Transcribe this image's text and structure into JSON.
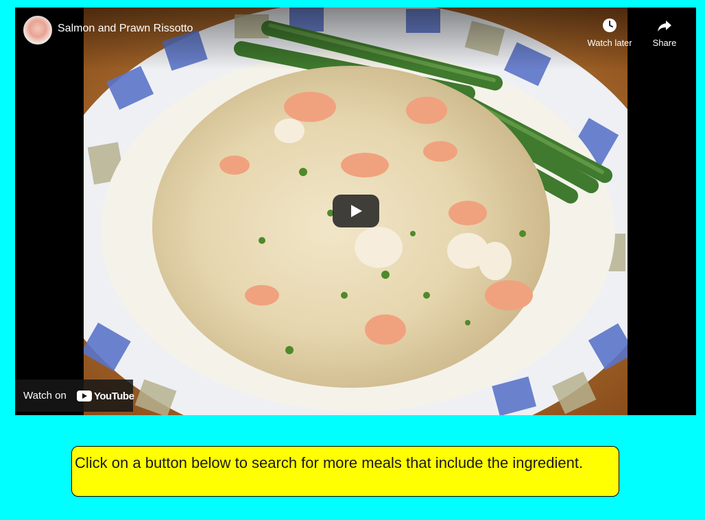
{
  "video": {
    "title": "Salmon and Prawn Rissotto",
    "channel_avatar_icon": "channel-avatar-icon",
    "actions": {
      "watch_later": "Watch later",
      "share": "Share"
    },
    "watch_on_label": "Watch on",
    "youtube_wordmark": "YouTube",
    "play_icon": "play-icon"
  },
  "info": {
    "text": "Click on a button below to search for more meals that include the ingredient."
  },
  "colors": {
    "page_background": "#00ffff",
    "info_background": "#ffff00",
    "video_background": "#000000"
  }
}
